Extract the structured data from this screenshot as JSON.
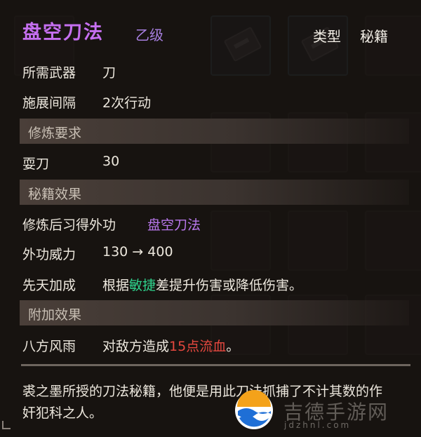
{
  "item": {
    "name": "盘空刀法",
    "grade": "乙级",
    "type_label": "类型",
    "type_value": "秘籍"
  },
  "info": [
    {
      "label": "所需武器",
      "value": "刀"
    },
    {
      "label": "施展间隔",
      "value": "2次行动"
    }
  ],
  "requirements": {
    "header": "修炼要求",
    "rows": [
      {
        "label": "耍刀",
        "value": "30"
      }
    ]
  },
  "effects": {
    "header": "秘籍效果",
    "learn_label": "修炼后习得外功",
    "learn_value": "盘空刀法",
    "power_label": "外功威力",
    "power_value": "130 → 400",
    "innate_label": "先天加成",
    "innate_pre": "根据",
    "innate_highlight": "敏捷",
    "innate_post": "差提升伤害或降低伤害。"
  },
  "extra": {
    "header": "附加效果",
    "label": "八方风雨",
    "pre": "对敌方造成",
    "highlight": "15点流血",
    "post": "。"
  },
  "description": "裘之墨所授的刀法秘籍，他便是用此刀法抓捕了不计其数的作奸犯科之人。",
  "watermark": {
    "text": "吉德手游网",
    "sub": "jdzhnl.com"
  },
  "colors": {
    "title": "#c56ff0",
    "highlight_green": "#2fd38d",
    "highlight_red": "#e6483f"
  }
}
